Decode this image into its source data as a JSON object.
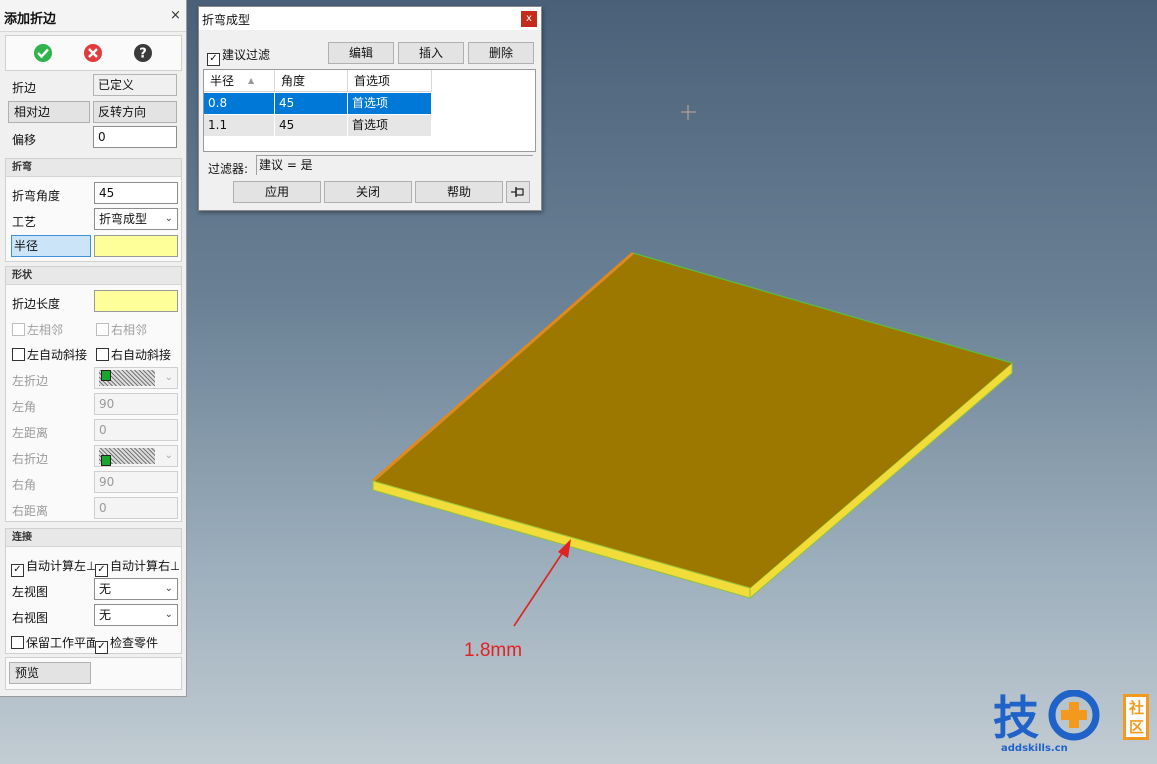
{
  "left_panel": {
    "title": "添加折边",
    "close": "×",
    "rows": {
      "flange_label": "折边",
      "flange_value": "已定义",
      "relative_button": "相对边",
      "reverse_button": "反转方向",
      "offset_label": "偏移",
      "offset_value": "0"
    },
    "bend": {
      "header": "折弯",
      "angle_label": "折弯角度",
      "angle_value": "45",
      "process_label": "工艺",
      "process_value": "折弯成型",
      "radius_label": "半径",
      "radius_value": ""
    },
    "shape": {
      "header": "形状",
      "length_label": "折边长度",
      "length_value": "",
      "left_adjacent": "左相邻",
      "right_adjacent": "右相邻",
      "left_auto_miter": "左自动斜接",
      "right_auto_miter": "右自动斜接",
      "left_flange_label": "左折边",
      "left_angle_label": "左角",
      "left_angle_value": "90",
      "left_distance_label": "左距离",
      "left_distance_value": "0",
      "right_flange_label": "右折边",
      "right_angle_label": "右角",
      "right_angle_value": "90",
      "right_distance_label": "右距离",
      "right_distance_value": "0"
    },
    "connect": {
      "header": "连接",
      "auto_left": "自动计算左⊥",
      "auto_right": "自动计算右⊥",
      "left_view_label": "左视图",
      "left_view_value": "无",
      "right_view_label": "右视图",
      "right_view_value": "无",
      "keep_plane": "保留工作平面",
      "check_part": "检查零件"
    },
    "preview_button": "预览"
  },
  "dialog": {
    "title": "折弯成型",
    "close": "x",
    "suggest_filter": "建议过滤",
    "edit": "编辑",
    "insert": "插入",
    "delete": "删除",
    "columns": [
      "半径",
      "角度",
      "首选项"
    ],
    "rows": [
      {
        "radius": "0.8",
        "angle": "45",
        "pref": "首选项"
      },
      {
        "radius": "1.1",
        "angle": "45",
        "pref": "首选项"
      }
    ],
    "filter_label": "过滤器:",
    "filter_value": "建议 = 是",
    "apply": "应用",
    "close_button": "关闭",
    "help": "帮助"
  },
  "viewport": {
    "annotation": "1.8mm"
  },
  "watermark": {
    "main": "技",
    "she": "社",
    "qu": "区",
    "url": "addskills.cn"
  },
  "colors": {
    "accept": "#2fb34a",
    "cancel": "#e23b3b",
    "selection": "#0078d7",
    "plate_top": "#9c7800",
    "plate_edge": "#f2dc3a",
    "annotation": "#e02222"
  }
}
